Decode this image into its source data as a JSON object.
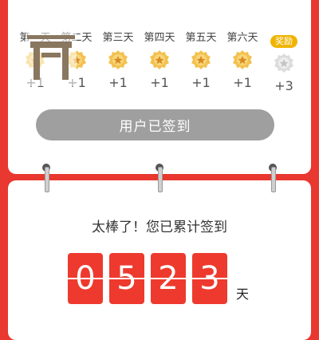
{
  "week": [
    {
      "label": "第一天",
      "bonus": "+1",
      "state": "done",
      "highlight": false
    },
    {
      "label": "第二天",
      "bonus": "+1",
      "state": "done",
      "highlight": false
    },
    {
      "label": "第三天",
      "bonus": "+1",
      "state": "done",
      "highlight": false
    },
    {
      "label": "第四天",
      "bonus": "+1",
      "state": "done",
      "highlight": false
    },
    {
      "label": "第五天",
      "bonus": "+1",
      "state": "done",
      "highlight": false
    },
    {
      "label": "第六天",
      "bonus": "+1",
      "state": "done",
      "highlight": false
    },
    {
      "label": "奖励",
      "bonus": "+3",
      "state": "pending",
      "highlight": true
    }
  ],
  "signed_button": {
    "label": "用户已签到"
  },
  "summary": {
    "message": "太棒了！您已累计签到",
    "digits": [
      "0",
      "5",
      "2",
      "3"
    ],
    "unit": "天"
  },
  "colors": {
    "background": "#e8382f",
    "medal_gold": "#f2c14e",
    "medal_grey": "#d9d9d9",
    "button_disabled": "#9f9f9f",
    "digit_bg": "#ee3a2e",
    "reward_badge": "#f0b400"
  },
  "icons": {
    "medal_done": "gold-medal-icon",
    "medal_pending": "grey-medal-icon"
  }
}
